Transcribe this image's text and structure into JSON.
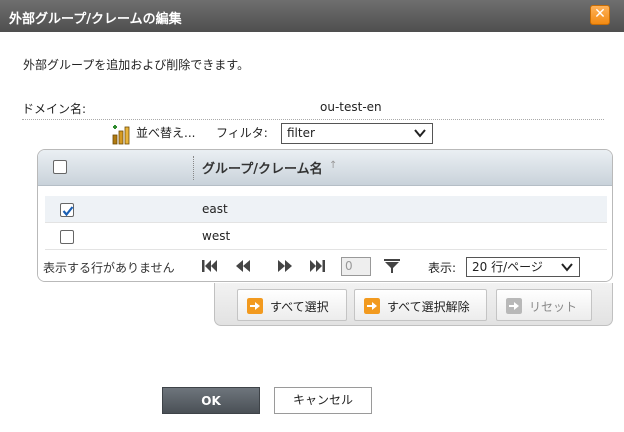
{
  "dialog": {
    "title": "外部グループ/クレームの編集",
    "close_label": "✕"
  },
  "description": "外部グループを追加および削除できます。",
  "domain": {
    "label": "ドメイン名:",
    "value": "ou-test-en"
  },
  "toolbar": {
    "sort_label": "並べ替え...",
    "filter_label": "フィルタ:",
    "filter_value": "filter"
  },
  "grid": {
    "column_header": "グループ/クレーム名",
    "rows": [
      {
        "name": "east",
        "checked": true
      },
      {
        "name": "west",
        "checked": false
      }
    ],
    "empty_message": "表示する行がありません",
    "page_value": "0",
    "per_page_label": "表示:",
    "per_page_value": "20 行/ページ"
  },
  "actions": {
    "select_all": "すべて選択",
    "deselect_all": "すべて選択解除",
    "reset": "リセット"
  },
  "buttons": {
    "ok": "OK",
    "cancel": "キャンセル"
  },
  "colors": {
    "title_bar": "#5a5a5a",
    "close_button": "#f28a12",
    "action_icon": "#f29a1f",
    "checkbox_check": "#1a5fb4",
    "ok_button": "#555c63"
  }
}
